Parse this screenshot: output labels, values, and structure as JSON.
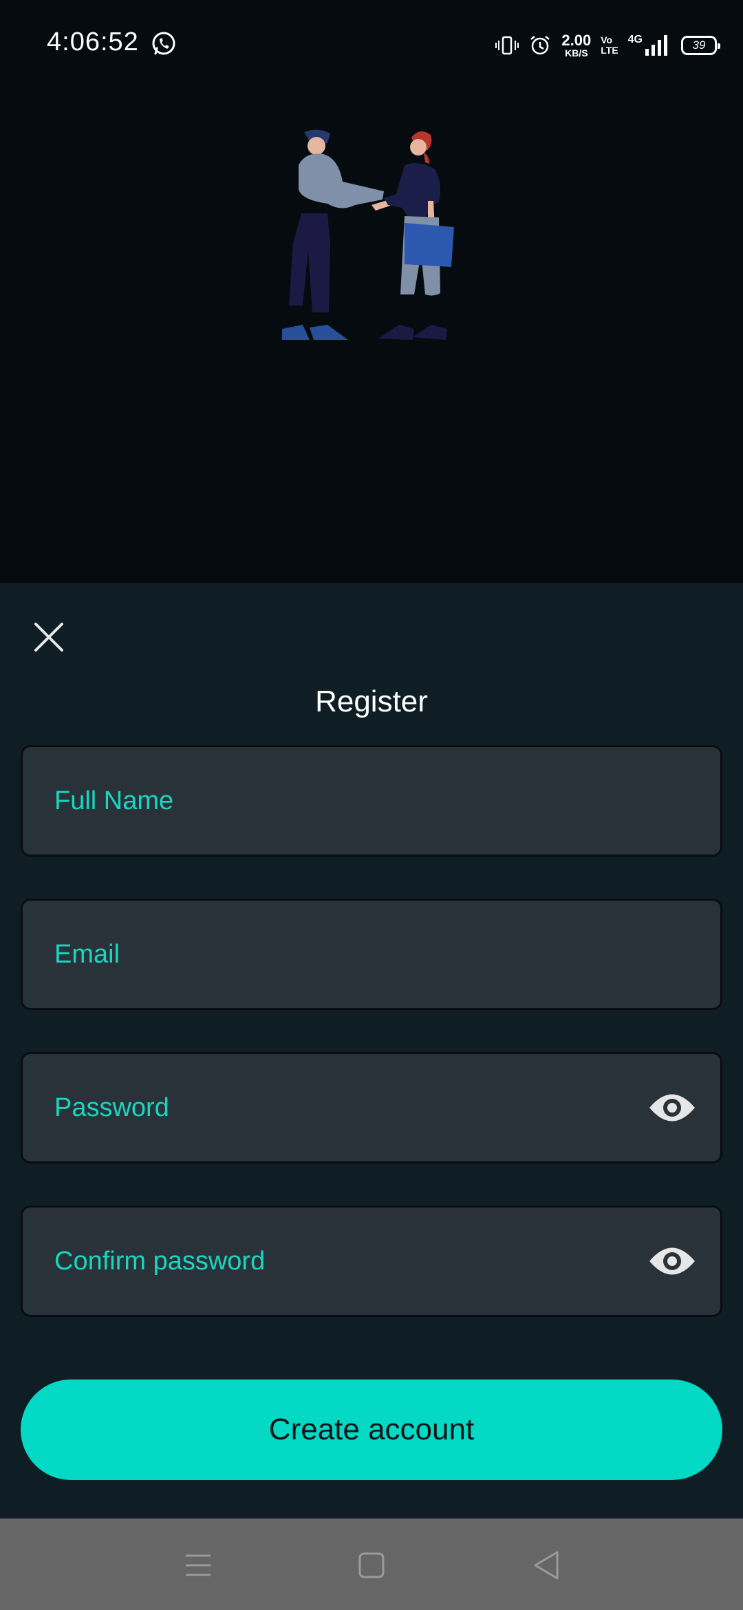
{
  "status_bar": {
    "time": "4:06:52",
    "net_speed_value": "2.00",
    "net_speed_unit": "KB/S",
    "volte_top": "Vo",
    "volte_bottom": "LTE",
    "network_type": "4G",
    "battery_level": "39",
    "icons": [
      "whatsapp-icon",
      "vibrate-icon",
      "alarm-icon",
      "signal-icon",
      "battery-icon"
    ]
  },
  "form": {
    "title": "Register",
    "full_name_placeholder": "Full Name",
    "email_placeholder": "Email",
    "password_placeholder": "Password",
    "confirm_password_placeholder": "Confirm password",
    "submit_label": "Create account"
  },
  "colors": {
    "background": "#050b0f",
    "sheet": "#0f1e25",
    "field": "#283238",
    "accent": "#03d9c4",
    "placeholder": "#1ad6c1",
    "nav_bar": "#666666"
  },
  "nav_bar": {
    "icons": [
      "menu-icon",
      "home-icon",
      "back-icon"
    ]
  }
}
